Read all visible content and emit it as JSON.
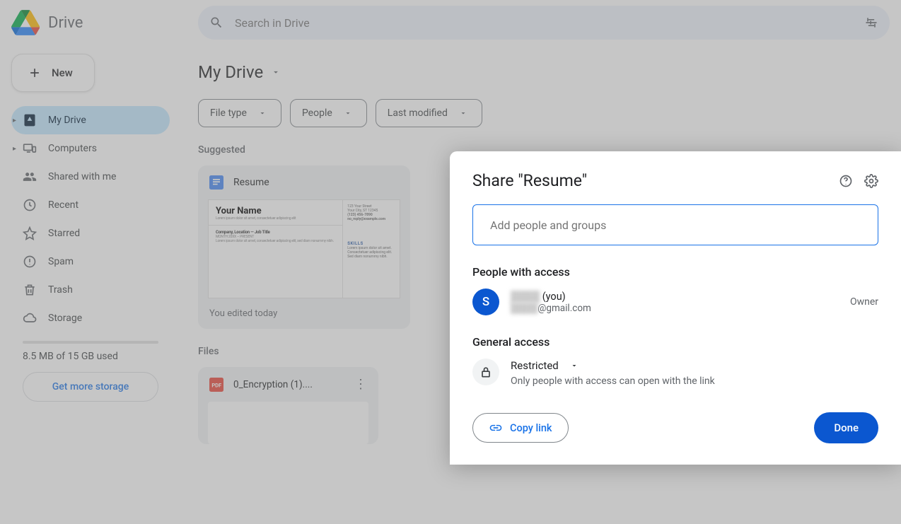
{
  "brand": "Drive",
  "search": {
    "placeholder": "Search in Drive"
  },
  "new_button": "New",
  "nav": [
    {
      "label": "My Drive",
      "has_caret": true,
      "selected": true
    },
    {
      "label": "Computers",
      "has_caret": true
    },
    {
      "label": "Shared with me"
    },
    {
      "label": "Recent"
    },
    {
      "label": "Starred"
    },
    {
      "label": "Spam"
    },
    {
      "label": "Trash"
    },
    {
      "label": "Storage"
    }
  ],
  "storage": {
    "used_text": "8.5 MB of 15 GB used",
    "cta": "Get more storage"
  },
  "breadcrumb": "My Drive",
  "filters": [
    {
      "label": "File type"
    },
    {
      "label": "People"
    },
    {
      "label": "Last modified"
    }
  ],
  "sections": {
    "suggested": "Suggested",
    "files": "Files"
  },
  "suggested_card": {
    "title": "Resume",
    "subtitle": "You edited today",
    "preview": {
      "name": "Your Name",
      "company_line": "Company, Location — Job Title",
      "skills_label": "SKILLS",
      "contact_phone": "(123) 456-7890"
    }
  },
  "file_card": {
    "title": "0_Encryption (1)...."
  },
  "share_dialog": {
    "title": "Share \"Resume\"",
    "input_placeholder": "Add people and groups",
    "people_heading": "People with access",
    "user": {
      "initial": "S",
      "name_suffix": "(you)",
      "email_suffix": "@gmail.com",
      "role": "Owner"
    },
    "general_heading": "General access",
    "restricted_label": "Restricted",
    "restricted_desc": "Only people with access can open with the link",
    "copy_link": "Copy link",
    "done": "Done"
  }
}
